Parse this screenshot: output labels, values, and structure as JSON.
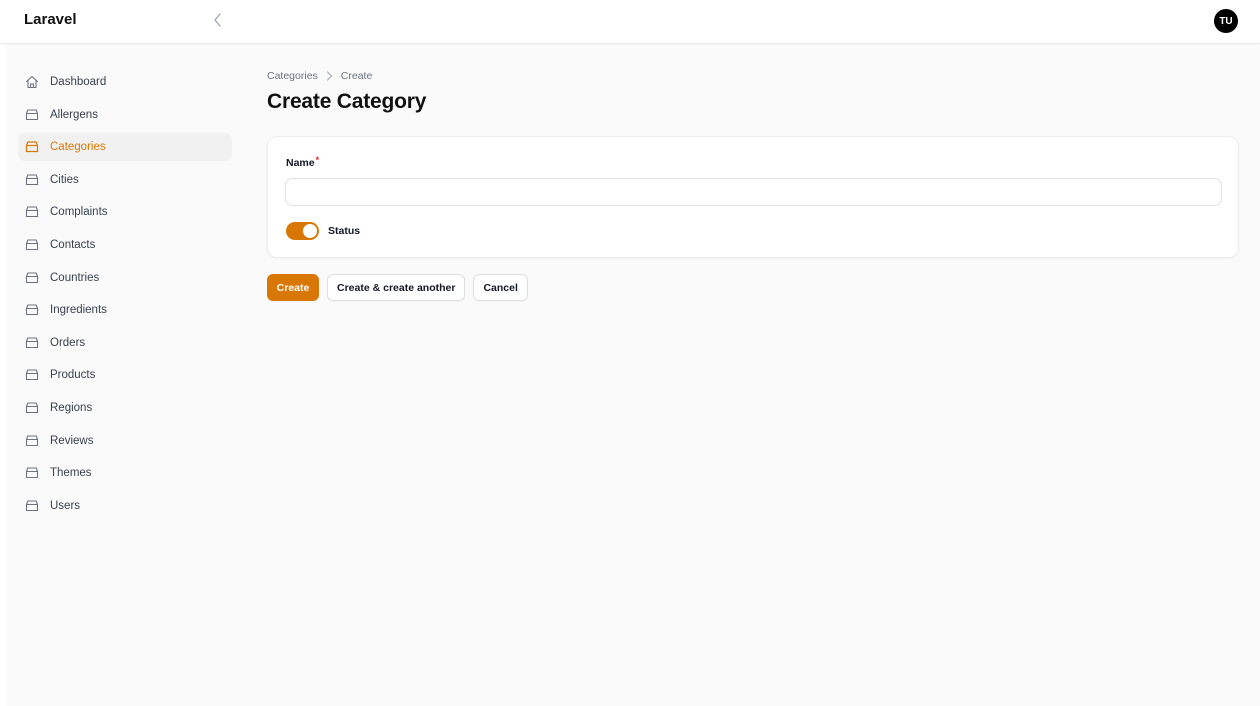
{
  "app": {
    "brand": "Laravel"
  },
  "user": {
    "initials": "TU"
  },
  "colors": {
    "accent": "#d97706",
    "text": "#111827",
    "muted": "#6b7280",
    "background": "#fafafa"
  },
  "icons": {
    "collapse": "chevron-left-icon",
    "dashboard": "home-icon",
    "resource": "archive-box-icon",
    "breadcrumb_separator": "chevron-right-icon"
  },
  "sidebar": {
    "items": [
      {
        "label": "Dashboard",
        "icon": "home-icon",
        "active": false
      },
      {
        "label": "Allergens",
        "icon": "archive-box-icon",
        "active": false
      },
      {
        "label": "Categories",
        "icon": "archive-box-icon",
        "active": true
      },
      {
        "label": "Cities",
        "icon": "archive-box-icon",
        "active": false
      },
      {
        "label": "Complaints",
        "icon": "archive-box-icon",
        "active": false
      },
      {
        "label": "Contacts",
        "icon": "archive-box-icon",
        "active": false
      },
      {
        "label": "Countries",
        "icon": "archive-box-icon",
        "active": false
      },
      {
        "label": "Ingredients",
        "icon": "archive-box-icon",
        "active": false
      },
      {
        "label": "Orders",
        "icon": "archive-box-icon",
        "active": false
      },
      {
        "label": "Products",
        "icon": "archive-box-icon",
        "active": false
      },
      {
        "label": "Regions",
        "icon": "archive-box-icon",
        "active": false
      },
      {
        "label": "Reviews",
        "icon": "archive-box-icon",
        "active": false
      },
      {
        "label": "Themes",
        "icon": "archive-box-icon",
        "active": false
      },
      {
        "label": "Users",
        "icon": "archive-box-icon",
        "active": false
      }
    ]
  },
  "breadcrumb": {
    "parent": "Categories",
    "current": "Create"
  },
  "page": {
    "title": "Create Category"
  },
  "form": {
    "name": {
      "label": "Name",
      "required_marker": "*",
      "value": "",
      "placeholder": ""
    },
    "status": {
      "label": "Status",
      "enabled": true
    }
  },
  "actions": {
    "create": "Create",
    "create_another": "Create & create another",
    "cancel": "Cancel"
  }
}
